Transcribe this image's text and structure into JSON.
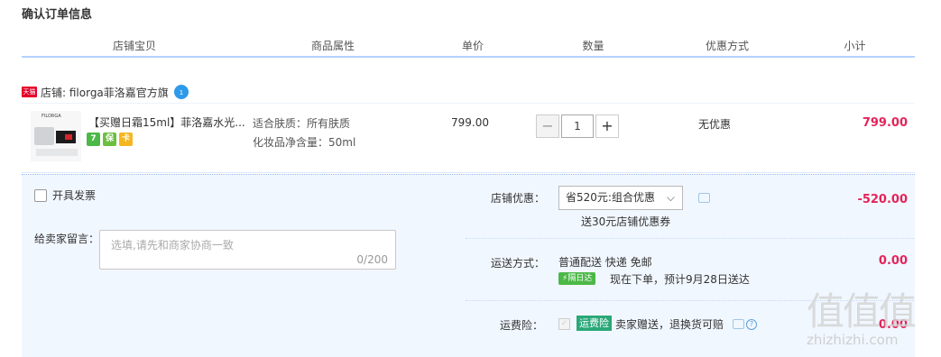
{
  "page_title": "确认订单信息",
  "columns": [
    "店铺宝贝",
    "商品属性",
    "单价",
    "数量",
    "优惠方式",
    "小计"
  ],
  "shop": {
    "badge": "天猫",
    "name": "店铺: filorga菲洛嘉官方旗",
    "chat_icon": "wangwang-chat-icon"
  },
  "item": {
    "thumb_brand": "FILORGA",
    "title": "【买赠日霜15ml】菲洛嘉水光...",
    "service_icons": [
      "7",
      "保",
      "卡"
    ],
    "attrs": [
      "适合肤质：所有肤质",
      "化妆品净含量：50ml"
    ],
    "unit_price": "799.00",
    "qty_minus": "−",
    "quantity": "1",
    "qty_plus": "+",
    "promo": "无优惠",
    "subtotal": "799.00"
  },
  "invoice": {
    "label": "开具发票"
  },
  "message": {
    "label": "给卖家留言：",
    "placeholder": "选填,请先和商家协商一致",
    "counter": "0/200"
  },
  "shop_discount": {
    "label": "店铺优惠：",
    "selected": "省520元:组合优惠",
    "chevron": "⌵",
    "note": "送30元店铺优惠券",
    "amount": "-520.00"
  },
  "shipping": {
    "label": "运送方式：",
    "method": "普通配送 快递 免邮",
    "badge": "隔日达",
    "note": "现在下单，预计9月28日送达",
    "amount": "0.00"
  },
  "insurance": {
    "label": "运费险：",
    "check": "✓",
    "tag": "运费险",
    "note": "卖家赠送，退换货可赔",
    "help": "?",
    "amount": "0.00"
  },
  "watermark": {
    "glyphs": "值值值",
    "text": "zhizhizhi.com"
  },
  "colors": {
    "price_red": "#e4245a",
    "header_blue": "#b2d1ff",
    "panel_bg": "#f1f7ff",
    "tmall_red": "#e4002b"
  }
}
